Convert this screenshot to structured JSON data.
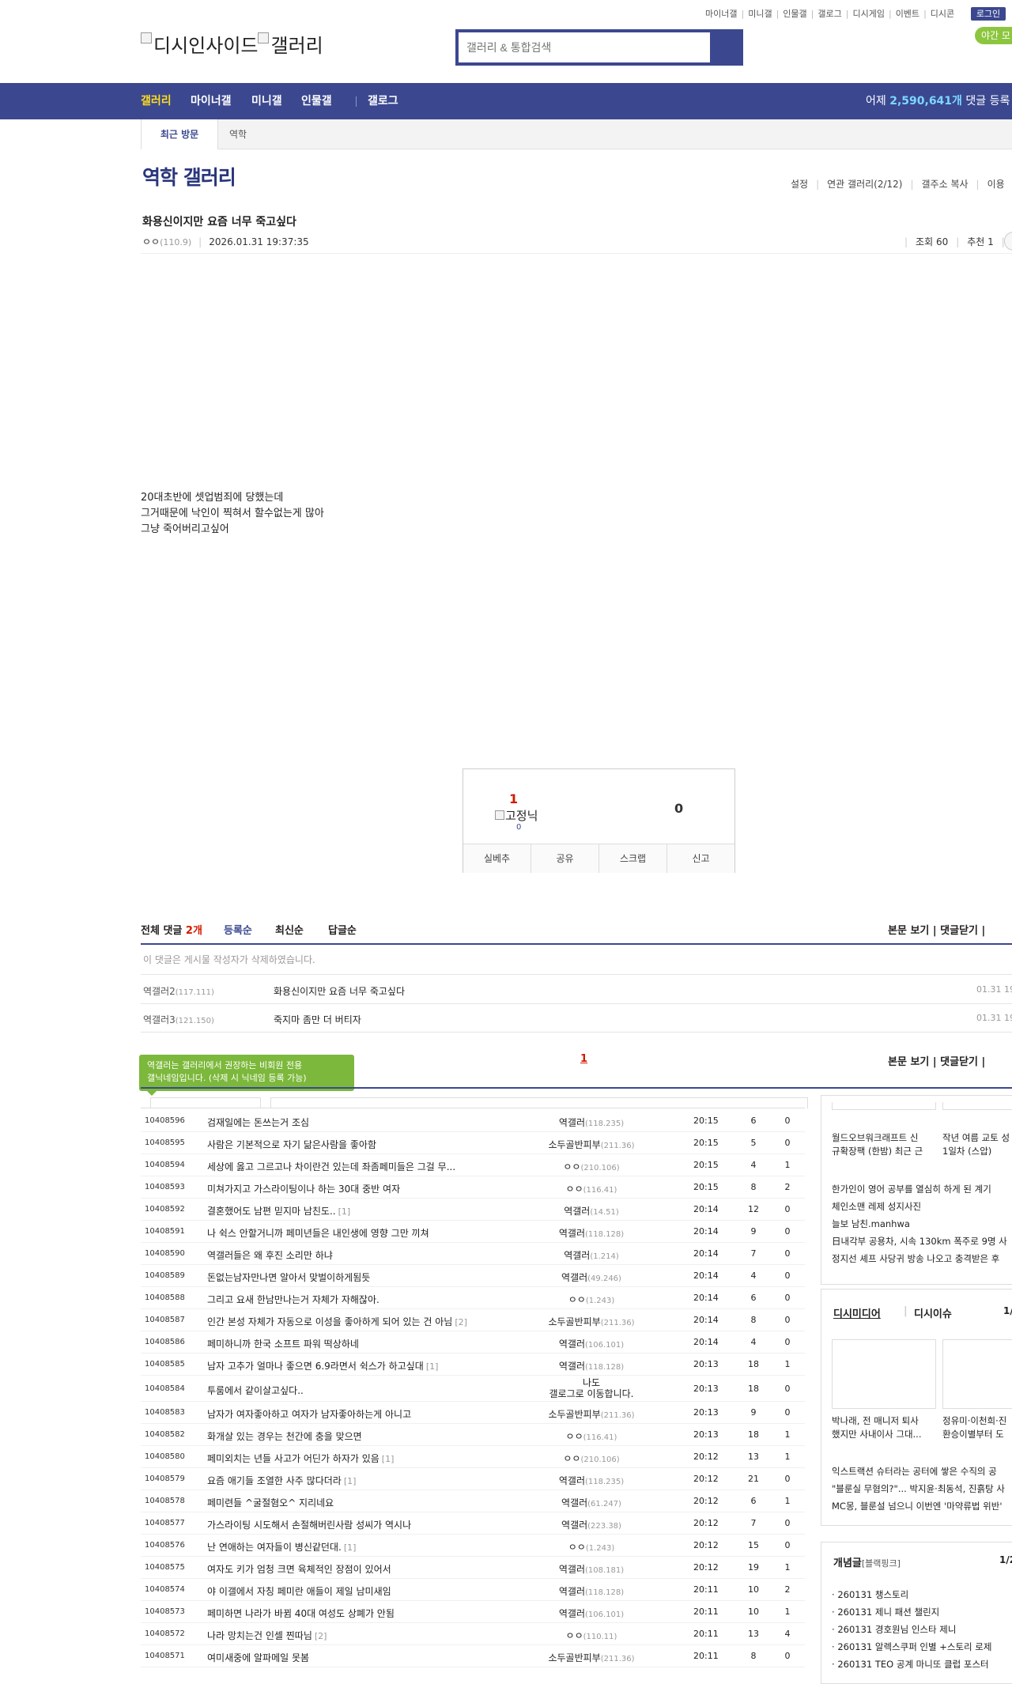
{
  "header": {
    "top_links": [
      "마이너갤",
      "미니갤",
      "인물갤",
      "갤로그",
      "디시게임",
      "이벤트",
      "디시콘"
    ],
    "login": "로그인",
    "night_mode": "야간 모",
    "logo_text": "디시인사이드",
    "logo_sub": "갤러리",
    "search_placeholder": "갤러리 & 통합검색"
  },
  "gnb": {
    "items": [
      "갤러리",
      "마이너갤",
      "미니갤",
      "인물갤",
      "갤로그"
    ],
    "stat_prefix": "어제 ",
    "stat_value": "2,590,641개",
    "stat_suffix": " 댓글 등록"
  },
  "recent": {
    "label": "최근 방문",
    "item": "역학"
  },
  "gallery": {
    "title": "역학 갤러리",
    "menu": [
      "설정",
      "연관 갤러리(2/12)",
      "갤주소 복사",
      "이용"
    ]
  },
  "post": {
    "title": "화용신이지만 요즘 너무 죽고싶다",
    "author": "ㅇㅇ",
    "ip": "(110.9)",
    "date": "2026.01.31 19:37:35",
    "views": "조회 60",
    "recommend": "추천 1",
    "body": [
      "20대초반에 셋업범죄에 당했는데",
      "그거때문에 낙인이 찍혀서 할수없는게 많아",
      "그냥 죽어버리고싶어"
    ]
  },
  "recommend_box": {
    "up": "1",
    "fixed_label": "고정닉",
    "fixed_count": "0",
    "down": "0",
    "buttons": [
      "실베추",
      "공유",
      "스크랩",
      "신고"
    ]
  },
  "comments": {
    "total_label": "전체 댓글 ",
    "total_count": "2개",
    "sort": [
      "등록순",
      "최신순",
      "답글순"
    ],
    "right_actions": "본문 보기  |  댓글닫기  |",
    "deleted_msg": "이 댓글은 게시물 작성자가 삭제하였습니다.",
    "items": [
      {
        "name": "역갤러2",
        "ip": "(117.111)",
        "text": "화용신이지만 요즘 너무 죽고싶다",
        "date": "01.31 19"
      },
      {
        "name": "역갤러3",
        "ip": "(121.150)",
        "text": "죽지마 좀만 더 버티자",
        "date": "01.31 19"
      }
    ],
    "page": "1",
    "tooltip_1": "역갤러는 갤러리에서 권장하는 비회원 전용",
    "tooltip_2": "갤닉네임입니다. (삭제 시 닉네임 등록 가능)"
  },
  "list": [
    {
      "no": "10408596",
      "title": "검재일에는 돈쓰는거 조심",
      "reply": "",
      "writer": "역갤러",
      "ip": "(118.235)",
      "time": "20:15",
      "views": "6",
      "rec": "0"
    },
    {
      "no": "10408595",
      "title": "사람은 기본적으로 자기 닮은사람을 좋아함",
      "reply": "",
      "writer": "소두골반피부",
      "ip": "(211.36)",
      "time": "20:15",
      "views": "5",
      "rec": "0"
    },
    {
      "no": "10408594",
      "title": "세상에 옳고 그르고나 차이란건 있는데 좌좀페미들은 그걸 무...",
      "reply": "",
      "writer": "ㅇㅇ",
      "ip": "(210.106)",
      "time": "20:15",
      "views": "4",
      "rec": "1"
    },
    {
      "no": "10408593",
      "title": "미쳐가지고 가스라이팅이나 하는 30대 중반 여자",
      "reply": "",
      "writer": "ㅇㅇ",
      "ip": "(116.41)",
      "time": "20:15",
      "views": "8",
      "rec": "2"
    },
    {
      "no": "10408592",
      "title": "결혼했어도 남편 믿지마 남친도..",
      "reply": "[1]",
      "writer": "역갤러",
      "ip": "(14.51)",
      "time": "20:14",
      "views": "12",
      "rec": "0"
    },
    {
      "no": "10408591",
      "title": "나 쉭스 안할거니까 페미년들은 내인생에 영향 그만 끼쳐",
      "reply": "",
      "writer": "역갤러",
      "ip": "(118.128)",
      "time": "20:14",
      "views": "9",
      "rec": "0"
    },
    {
      "no": "10408590",
      "title": "역갤러들은 왜 후진 소리만 하냐",
      "reply": "",
      "writer": "역갤러",
      "ip": "(1.214)",
      "time": "20:14",
      "views": "7",
      "rec": "0"
    },
    {
      "no": "10408589",
      "title": "돈없는남자만나면 알아서 맞벌이하게됨듯",
      "reply": "",
      "writer": "역갤러",
      "ip": "(49.246)",
      "time": "20:14",
      "views": "4",
      "rec": "0"
    },
    {
      "no": "10408588",
      "title": "그리고 요새 한남만나는거 자체가 자해잖아.",
      "reply": "",
      "writer": "ㅇㅇ",
      "ip": "(1.243)",
      "time": "20:14",
      "views": "6",
      "rec": "0"
    },
    {
      "no": "10408587",
      "title": "인간 본성 자체가 자동으로 이성을 좋아하게 되어 있는 건 아님",
      "reply": "[2]",
      "writer": "소두골반피부",
      "ip": "(211.36)",
      "time": "20:14",
      "views": "8",
      "rec": "0"
    },
    {
      "no": "10408586",
      "title": "페미하니까 한국 소프트 파워 떡상하네",
      "reply": "",
      "writer": "역갤러",
      "ip": "(106.101)",
      "time": "20:14",
      "views": "4",
      "rec": "0"
    },
    {
      "no": "10408585",
      "title": "남자 고추가 얼마나 좋으면 6.9라면서 쉭스가 하고싶대",
      "reply": "[1]",
      "writer": "역갤러",
      "ip": "(118.128)",
      "time": "20:13",
      "views": "18",
      "rec": "1"
    },
    {
      "no": "10408584",
      "title": "투룸에서 같이살고싶다..",
      "reply": "",
      "writer": "나도",
      "ip": "",
      "writer2": "갤로그로 이동합니다.",
      "time": "20:13",
      "views": "18",
      "rec": "0"
    },
    {
      "no": "10408583",
      "title": "남자가 여자좋아하고 여자가 남자좋아하는게 아니고",
      "reply": "",
      "writer": "소두골반피부",
      "ip": "(211.36)",
      "time": "20:13",
      "views": "9",
      "rec": "0"
    },
    {
      "no": "10408582",
      "title": "화개살 있는 경우는 천간에 충을 맞으면",
      "reply": "",
      "writer": "ㅇㅇ",
      "ip": "(116.41)",
      "time": "20:13",
      "views": "18",
      "rec": "1"
    },
    {
      "no": "10408580",
      "title": "페미외치는 년들 사고가 어딘가 하자가 있음",
      "reply": "[1]",
      "writer": "ㅇㅇ",
      "ip": "(210.106)",
      "time": "20:12",
      "views": "13",
      "rec": "1"
    },
    {
      "no": "10408579",
      "title": "요즘 애기들 조열한 사주 많다더라",
      "reply": "[1]",
      "writer": "역갤러",
      "ip": "(118.235)",
      "time": "20:12",
      "views": "21",
      "rec": "0"
    },
    {
      "no": "10408578",
      "title": "페미련들 ^굴절혐오^ 지리네요",
      "reply": "",
      "writer": "역갤러",
      "ip": "(61.247)",
      "time": "20:12",
      "views": "6",
      "rec": "1"
    },
    {
      "no": "10408577",
      "title": "가스라이팅 시도해서 손절해버린사람 성씨가 역시나",
      "reply": "",
      "writer": "역갤러",
      "ip": "(223.38)",
      "time": "20:12",
      "views": "7",
      "rec": "0"
    },
    {
      "no": "10408576",
      "title": "난 연애하는 여자들이 병신같던대.",
      "reply": "[1]",
      "writer": "ㅇㅇ",
      "ip": "(1.243)",
      "time": "20:12",
      "views": "15",
      "rec": "0"
    },
    {
      "no": "10408575",
      "title": "여자도 키가 엄청 크면 육체적인 장점이 있어서",
      "reply": "",
      "writer": "역갤러",
      "ip": "(108.181)",
      "time": "20:12",
      "views": "19",
      "rec": "1"
    },
    {
      "no": "10408574",
      "title": "야 이갤에서 자칭 페미란 애들이 제일 남미새임",
      "reply": "",
      "writer": "역갤러",
      "ip": "(118.128)",
      "time": "20:11",
      "views": "10",
      "rec": "2"
    },
    {
      "no": "10408573",
      "title": "페미하면 나라가 바뀜 40대 여성도 상폐가 안됨",
      "reply": "",
      "writer": "역갤러",
      "ip": "(106.101)",
      "time": "20:11",
      "views": "10",
      "rec": "1"
    },
    {
      "no": "10408572",
      "title": "나라 망치는건 인셀 찐따님",
      "reply": "[2]",
      "writer": "ㅇㅇ",
      "ip": "(110.11)",
      "time": "20:11",
      "views": "13",
      "rec": "4"
    },
    {
      "no": "10408571",
      "title": "여미새중에 알파메일 못봄",
      "reply": "",
      "writer": "소두골반피부",
      "ip": "(211.36)",
      "time": "20:11",
      "views": "8",
      "rec": "0"
    }
  ],
  "right": {
    "box1": {
      "cap1": [
        "월드오브워크래프트 신",
        "규확장팩 (한밤) 최근 근"
      ],
      "cap2": [
        "작년 여름 교토 성",
        "1일차 (스압)"
      ],
      "lines": [
        "한가인이 영어 공부를 열심히 하게 된 계기",
        "체인소맨 레제 성지사진",
        "늘보 남친.manhwa",
        "日내각부 공용차, 시속 130km 폭주로 9명 사",
        "정지선 셰프 사당귀 방송 나오고 충격받은 후"
      ]
    },
    "box2": {
      "tabs": [
        "디시미디어",
        "디시이슈"
      ],
      "page": "1/",
      "cap1": [
        "박나래, 전 매니저 퇴사",
        "했지만 사내이사 그대..."
      ],
      "cap2": [
        "정유미·이천희·진",
        "환승이별부터 도"
      ],
      "lines": [
        "익스트랙션 슈터라는 공터에 쌓은 수직의 공",
        "\"블룬실 무혐의?\"... 박지윤·최동석, 진흙탕 사",
        "MC몽, 블룬설 넘으니 이번엔 '마약류법 위반'"
      ]
    },
    "box3": {
      "title": "개념글",
      "subtitle": "[블랙핑크]",
      "page": "1/2",
      "lines": [
        "260131 챙스토리",
        "260131 제니 패션 챌린지",
        "260131 경호원님 인스타 제니",
        "260131 알렉스쿠퍼 인별 +스토리 로제",
        "260131 TEO 공계 마니또 클럽 포스터"
      ]
    }
  }
}
